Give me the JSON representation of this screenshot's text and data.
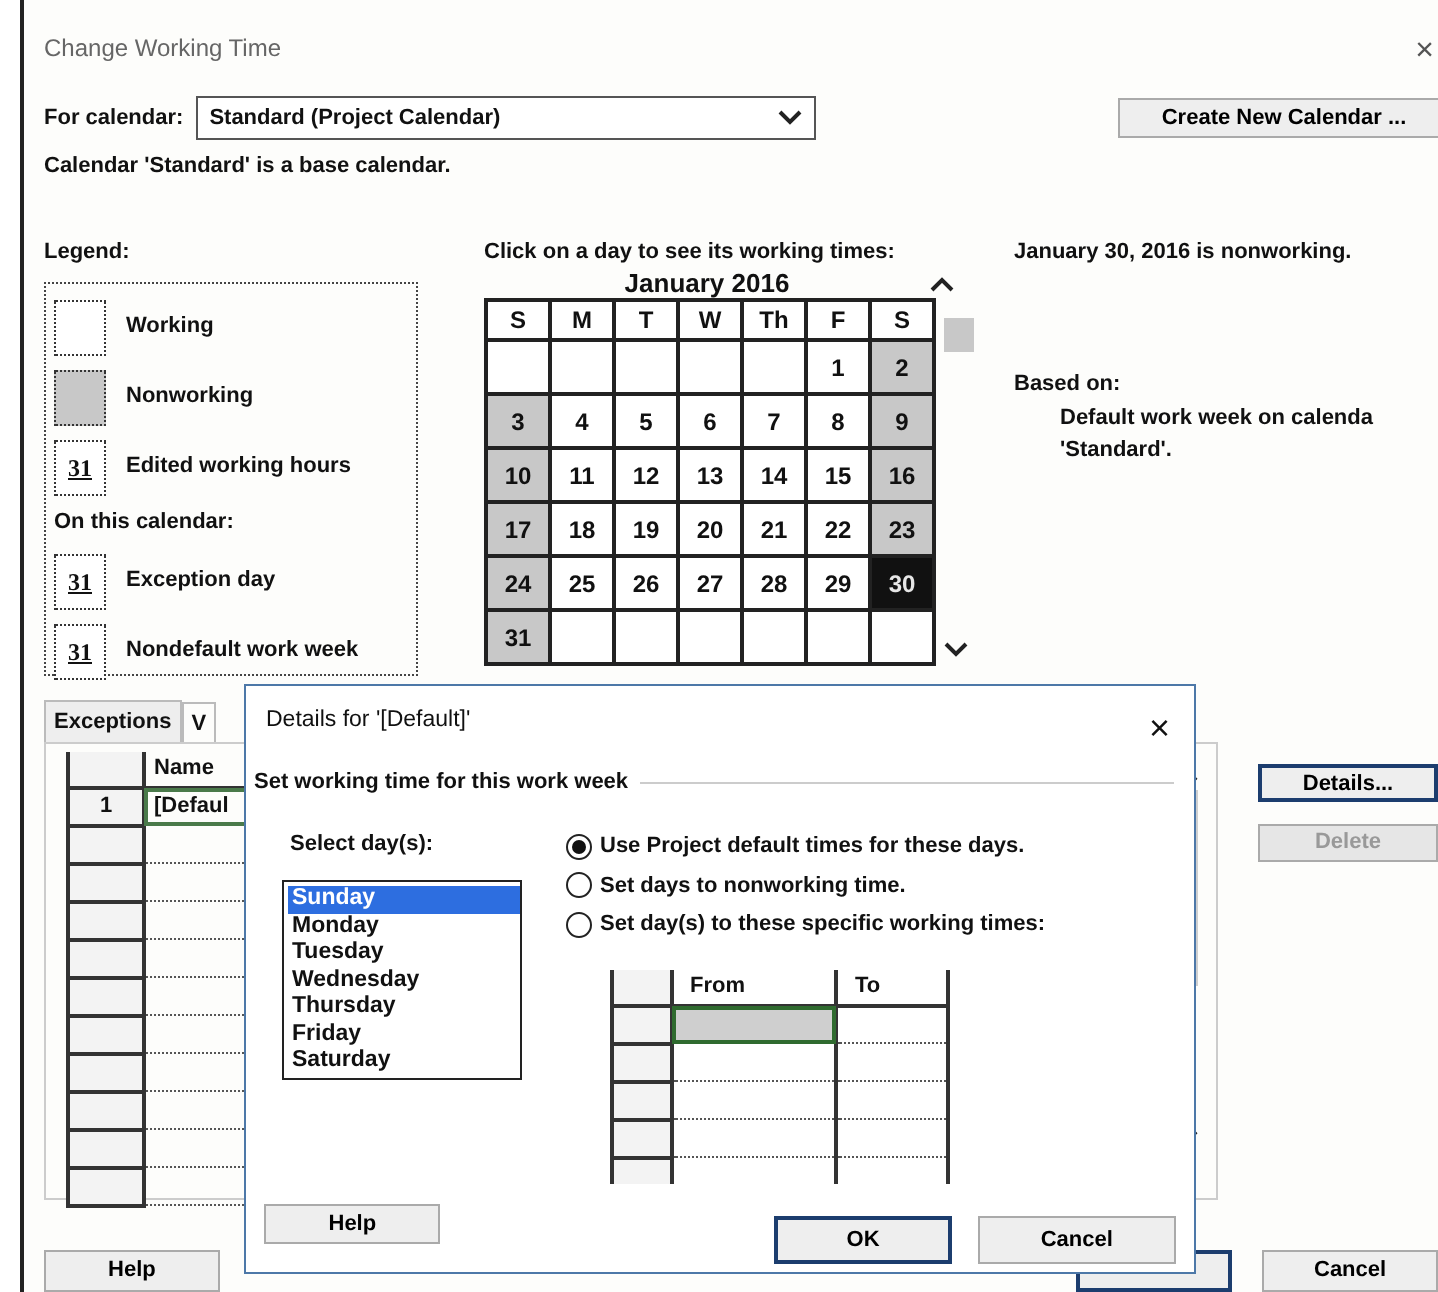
{
  "window": {
    "title": "Change Working Time",
    "close": "×"
  },
  "calendar_picker": {
    "label": "For calendar:",
    "value": "Standard (Project Calendar)"
  },
  "create_button": "Create New Calendar ...",
  "base_note": "Calendar 'Standard' is a base calendar.",
  "legend": {
    "title": "Legend:",
    "subtitle": "On this calendar:",
    "items": [
      {
        "kind": "working",
        "label": "Working"
      },
      {
        "kind": "nonworking",
        "label": "Nonworking"
      },
      {
        "kind": "edited",
        "glyph": "31",
        "label": "Edited working hours"
      }
    ],
    "calendar_items": [
      {
        "glyph": "31",
        "label": "Exception day"
      },
      {
        "glyph": "31",
        "label": "Nondefault work week"
      }
    ]
  },
  "calendar": {
    "prompt": "Click on a day to see its working times:",
    "month": "January 2016",
    "weekdays": [
      "S",
      "M",
      "T",
      "W",
      "Th",
      "F",
      "S"
    ],
    "weeks": [
      {
        "days": [
          {
            "day": "1",
            "nonworking": false,
            "selected": false
          },
          {
            "day": "2",
            "nonworking": true,
            "selected": false
          }
        ]
      },
      {
        "days": [
          {
            "day": "3",
            "nonworking": true,
            "selected": false
          },
          {
            "day": "4",
            "nonworking": false,
            "selected": false
          },
          {
            "day": "5",
            "nonworking": false,
            "selected": false
          },
          {
            "day": "6",
            "nonworking": false,
            "selected": false
          },
          {
            "day": "7",
            "nonworking": false,
            "selected": false
          },
          {
            "day": "8",
            "nonworking": false,
            "selected": false
          },
          {
            "day": "9",
            "nonworking": true,
            "selected": false
          }
        ]
      },
      {
        "days": [
          {
            "day": "10",
            "nonworking": true,
            "selected": false
          },
          {
            "day": "11",
            "nonworking": false,
            "selected": false
          },
          {
            "day": "12",
            "nonworking": false,
            "selected": false
          },
          {
            "day": "13",
            "nonworking": false,
            "selected": false
          },
          {
            "day": "14",
            "nonworking": false,
            "selected": false
          },
          {
            "day": "15",
            "nonworking": false,
            "selected": false
          },
          {
            "day": "16",
            "nonworking": true,
            "selected": false
          }
        ]
      },
      {
        "days": [
          {
            "day": "17",
            "nonworking": true,
            "selected": false
          },
          {
            "day": "18",
            "nonworking": false,
            "selected": false
          },
          {
            "day": "19",
            "nonworking": false,
            "selected": false
          },
          {
            "day": "20",
            "nonworking": false,
            "selected": false
          },
          {
            "day": "21",
            "nonworking": false,
            "selected": false
          },
          {
            "day": "22",
            "nonworking": false,
            "selected": false
          },
          {
            "day": "23",
            "nonworking": true,
            "selected": false
          }
        ]
      },
      {
        "days": [
          {
            "day": "24",
            "nonworking": true,
            "selected": false
          },
          {
            "day": "25",
            "nonworking": false,
            "selected": false
          },
          {
            "day": "26",
            "nonworking": false,
            "selected": false
          },
          {
            "day": "27",
            "nonworking": false,
            "selected": false
          },
          {
            "day": "28",
            "nonworking": false,
            "selected": false
          },
          {
            "day": "29",
            "nonworking": false,
            "selected": false
          },
          {
            "day": "30",
            "nonworking": true,
            "selected": true
          }
        ]
      },
      {
        "days": [
          {
            "day": "31",
            "nonworking": true,
            "selected": false
          }
        ]
      }
    ]
  },
  "day_info": {
    "status": "January 30, 2016 is nonworking.",
    "based_on_label": "Based on:",
    "based_on": [
      "Default work week on calenda",
      "'Standard'."
    ]
  },
  "tabs": [
    {
      "label": "Exceptions",
      "selected": false
    },
    {
      "label": "V",
      "selected": true
    }
  ],
  "work_weeks": {
    "columns": [
      "Name"
    ],
    "rows": [
      {
        "number": "1",
        "name": "[Defaul",
        "selected": true
      }
    ]
  },
  "side_buttons": [
    {
      "label": "Details...",
      "disabled": false,
      "focused": true
    },
    {
      "label": "Delete",
      "disabled": true,
      "focused": false
    }
  ],
  "footer": {
    "help": "Help",
    "cancel": "Cancel"
  },
  "details_dialog": {
    "title": "Details for '[Default]'",
    "close": "×",
    "section": "Set working time for this work week",
    "days_label": "Select day(s):",
    "days": [
      {
        "label": "Sunday",
        "selected": true
      },
      {
        "label": "Monday",
        "selected": false
      },
      {
        "label": "Tuesday",
        "selected": false
      },
      {
        "label": "Wednesday",
        "selected": false
      },
      {
        "label": "Thursday",
        "selected": false
      },
      {
        "label": "Friday",
        "selected": false
      },
      {
        "label": "Saturday",
        "selected": false
      }
    ],
    "options": [
      {
        "label": "Use Project default times for these days.",
        "selected": true
      },
      {
        "label": "Set days to nonworking time.",
        "selected": false
      },
      {
        "label": "Set day(s) to these specific working times:",
        "selected": false
      }
    ],
    "times": {
      "columns": [
        "From",
        "To"
      ]
    },
    "buttons": [
      {
        "kind": "help",
        "label": "Help",
        "focused": false
      },
      {
        "kind": "ok",
        "label": "OK",
        "focused": true
      },
      {
        "kind": "cancel",
        "label": "Cancel",
        "focused": false
      }
    ]
  }
}
